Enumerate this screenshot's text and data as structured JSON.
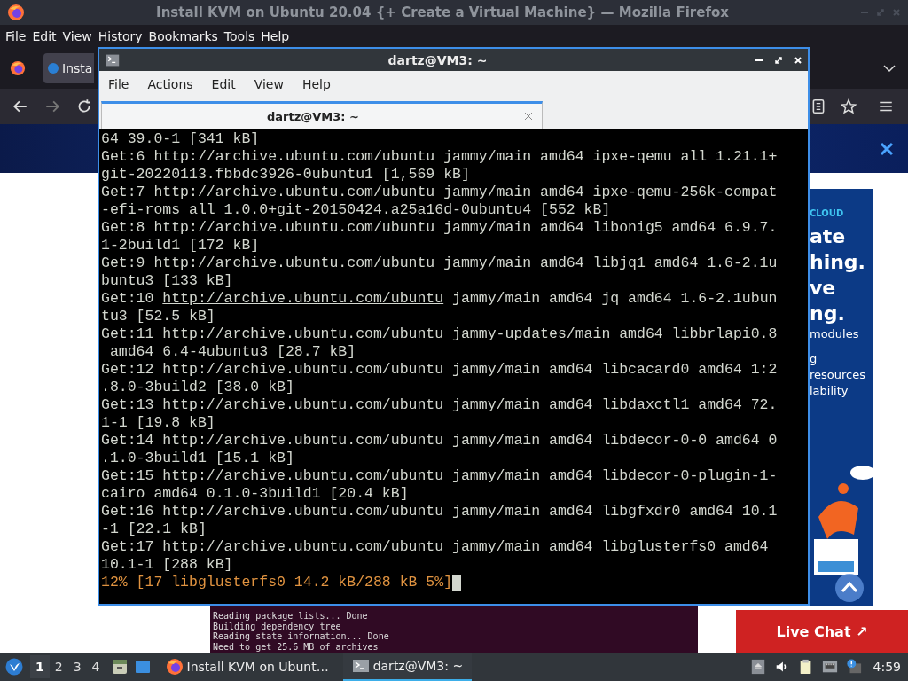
{
  "browser": {
    "title": "Install KVM on Ubuntu 20.04 {+ Create a Virtual Machine} — Mozilla Firefox",
    "menu": [
      "File",
      "Edit",
      "View",
      "History",
      "Bookmarks",
      "Tools",
      "Help"
    ],
    "tab": {
      "label": "Insta",
      "selected": true
    }
  },
  "page": {
    "ad_lines": [
      {
        "kind": "eyebrow",
        "text": "CLOUD"
      },
      {
        "kind": "headline",
        "text": "ate"
      },
      {
        "kind": "headline",
        "text": "hing."
      },
      {
        "kind": "headline",
        "text": "ve"
      },
      {
        "kind": "headline",
        "text": "ng."
      },
      {
        "kind": "body",
        "text": "modules"
      },
      {
        "kind": "gap",
        "text": "g"
      },
      {
        "kind": "body",
        "text": "resources"
      },
      {
        "kind": "body",
        "text": "lability"
      }
    ],
    "console_lines": [
      "Reading package lists... Done",
      "Building dependency tree",
      "Reading state information... Done",
      "Need to get 25.6 MB of archives"
    ],
    "live_chat": "Live Chat ↗"
  },
  "terminal": {
    "title": "dartz@VM3: ~",
    "menu": [
      "File",
      "Actions",
      "Edit",
      "View",
      "Help"
    ],
    "tab": {
      "label": "dartz@VM3: ~",
      "selected": true
    },
    "lines": [
      {
        "kind": "plain",
        "text": "64 39.0-1 [341 kB]"
      },
      {
        "kind": "plain",
        "text": "Get:6 http://archive.ubuntu.com/ubuntu jammy/main amd64 ipxe-qemu all 1.21.1+"
      },
      {
        "kind": "plain",
        "text": "git-20220113.fbbdc3926-0ubuntu1 [1,569 kB]"
      },
      {
        "kind": "plain",
        "text": "Get:7 http://archive.ubuntu.com/ubuntu jammy/main amd64 ipxe-qemu-256k-compat"
      },
      {
        "kind": "plain",
        "text": "-efi-roms all 1.0.0+git-20150424.a25a16d-0ubuntu4 [552 kB]"
      },
      {
        "kind": "plain",
        "text": "Get:8 http://archive.ubuntu.com/ubuntu jammy/main amd64 libonig5 amd64 6.9.7."
      },
      {
        "kind": "plain",
        "text": "1-2build1 [172 kB]"
      },
      {
        "kind": "plain",
        "text": "Get:9 http://archive.ubuntu.com/ubuntu jammy/main amd64 libjq1 amd64 1.6-2.1u"
      },
      {
        "kind": "plain",
        "text": "buntu3 [133 kB]"
      },
      {
        "kind": "link",
        "before": "Get:10 ",
        "link": "http://archive.ubuntu.com/ubuntu",
        "after": " jammy/main amd64 jq amd64 1.6-2.1ubun"
      },
      {
        "kind": "plain",
        "text": "tu3 [52.5 kB]"
      },
      {
        "kind": "plain",
        "text": "Get:11 http://archive.ubuntu.com/ubuntu jammy-updates/main amd64 libbrlapi0.8"
      },
      {
        "kind": "plain",
        "text": " amd64 6.4-4ubuntu3 [28.7 kB]"
      },
      {
        "kind": "plain",
        "text": "Get:12 http://archive.ubuntu.com/ubuntu jammy/main amd64 libcacard0 amd64 1:2"
      },
      {
        "kind": "plain",
        "text": ".8.0-3build2 [38.0 kB]"
      },
      {
        "kind": "plain",
        "text": "Get:13 http://archive.ubuntu.com/ubuntu jammy/main amd64 libdaxctl1 amd64 72."
      },
      {
        "kind": "plain",
        "text": "1-1 [19.8 kB]"
      },
      {
        "kind": "plain",
        "text": "Get:14 http://archive.ubuntu.com/ubuntu jammy/main amd64 libdecor-0-0 amd64 0"
      },
      {
        "kind": "plain",
        "text": ".1.0-3build1 [15.1 kB]"
      },
      {
        "kind": "plain",
        "text": "Get:15 http://archive.ubuntu.com/ubuntu jammy/main amd64 libdecor-0-plugin-1-"
      },
      {
        "kind": "plain",
        "text": "cairo amd64 0.1.0-3build1 [20.4 kB]"
      },
      {
        "kind": "plain",
        "text": "Get:16 http://archive.ubuntu.com/ubuntu jammy/main amd64 libgfxdr0 amd64 10.1"
      },
      {
        "kind": "plain",
        "text": "-1 [22.1 kB]"
      },
      {
        "kind": "plain",
        "text": "Get:17 http://archive.ubuntu.com/ubuntu jammy/main amd64 libglusterfs0 amd64"
      },
      {
        "kind": "plain",
        "text": "10.1-1 [288 kB]"
      },
      {
        "kind": "progress",
        "text": "12% [17 libglusterfs0 14.2 kB/288 kB 5%]"
      }
    ]
  },
  "taskbar": {
    "workspaces": [
      {
        "label": "1",
        "selected": true
      },
      {
        "label": "2",
        "selected": false
      },
      {
        "label": "3",
        "selected": false
      },
      {
        "label": "4",
        "selected": false
      }
    ],
    "tasks": [
      {
        "kind": "browser",
        "label": "Install KVM on Ubunt…",
        "selected": false
      },
      {
        "kind": "terminal",
        "label": "dartz@VM3: ~",
        "selected": true
      }
    ],
    "clock": "4:59"
  }
}
